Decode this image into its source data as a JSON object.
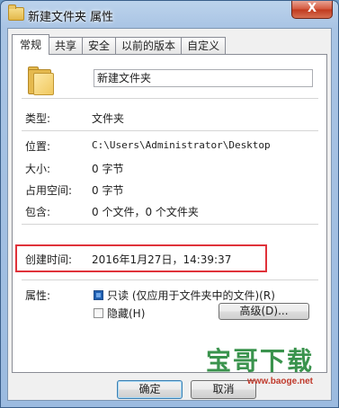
{
  "window": {
    "title": "新建文件夹 属性",
    "close_label": "X"
  },
  "tabs": [
    {
      "label": "常规",
      "active": true
    },
    {
      "label": "共享"
    },
    {
      "label": "安全"
    },
    {
      "label": "以前的版本"
    },
    {
      "label": "自定义"
    }
  ],
  "general": {
    "name": "新建文件夹",
    "type_label": "类型:",
    "type_value": "文件夹",
    "location_label": "位置:",
    "location_value": "C:\\Users\\Administrator\\Desktop",
    "size_label": "大小:",
    "size_value": "0 字节",
    "disk_label": "占用空间:",
    "disk_value": "0 字节",
    "contains_label": "包含:",
    "contains_value": "0 个文件，0 个文件夹",
    "created_label": "创建时间:",
    "created_value": "2016年1月27日，14:39:37",
    "attributes_label": "属性:",
    "readonly_label": "只读 (仅应用于文件夹中的文件)(R)",
    "hidden_label": "隐藏(H)",
    "advanced_label": "高级(D)..."
  },
  "buttons": {
    "ok": "确定",
    "cancel": "取消"
  },
  "watermark": {
    "text": "宝哥下载",
    "url": "www.baoge.net"
  },
  "colors": {
    "highlight": "#e0323a",
    "titlebar": "#a9c4e4"
  }
}
